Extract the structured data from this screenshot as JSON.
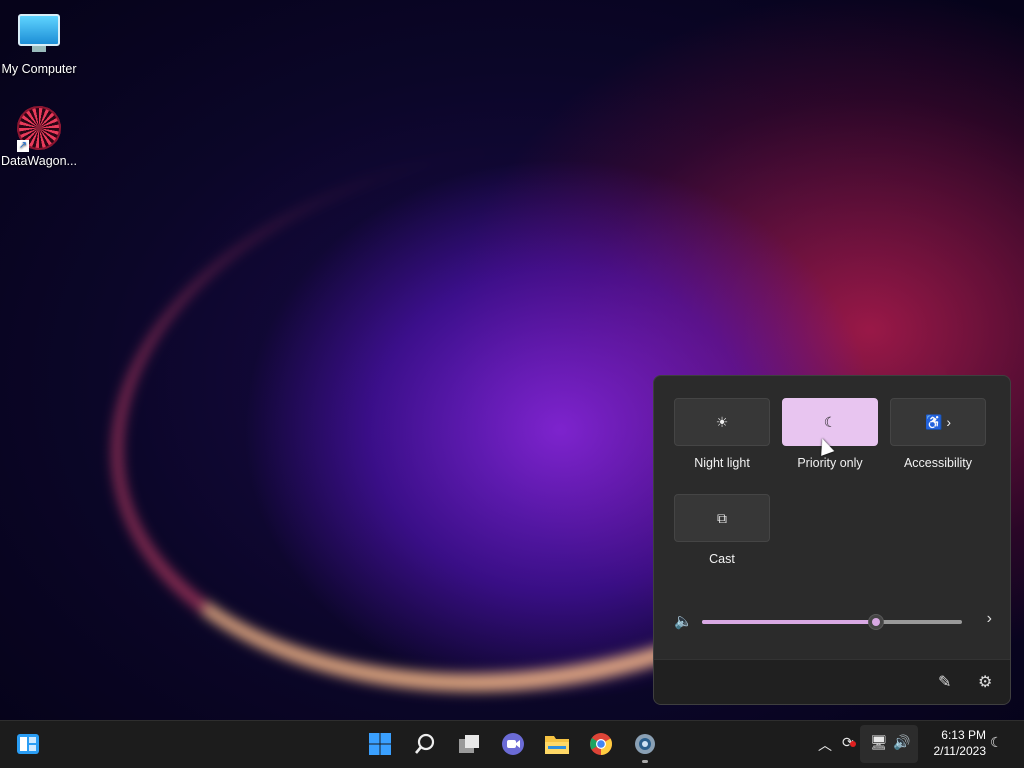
{
  "desktop": {
    "icons": [
      {
        "label": "My Computer",
        "icon": "monitor-icon"
      },
      {
        "label": "DataWagon...",
        "icon": "datawagon-icon"
      }
    ]
  },
  "quick_settings": {
    "tiles": [
      {
        "label": "Night light",
        "icon": "night-light-icon",
        "glyph": "☀",
        "active": false
      },
      {
        "label": "Priority only",
        "icon": "moon-icon",
        "glyph": "☾",
        "active": true
      },
      {
        "label": "Accessibility",
        "icon": "accessibility-icon",
        "glyph": "♿ ›",
        "active": false
      },
      {
        "label": "Cast",
        "icon": "cast-icon",
        "glyph": "⧉",
        "active": false
      }
    ],
    "volume": {
      "level_percent": 67,
      "accent": "#d9a9e4"
    },
    "footer": {
      "edit_icon": "pencil-icon",
      "settings_icon": "gear-icon"
    }
  },
  "taskbar": {
    "apps": [
      "widgets-icon",
      "start-icon",
      "search-icon",
      "task-view-icon",
      "teams-chat-icon",
      "file-explorer-icon",
      "chrome-icon",
      "settings-app-icon"
    ],
    "tray": [
      "chevron-up-icon",
      "sync-icon",
      "network-icon",
      "volume-icon",
      "focus-moon-icon"
    ],
    "clock": {
      "time": "6:13 PM",
      "date": "2/11/2023"
    }
  },
  "colors": {
    "accent": "#e8c5f0",
    "panel": "#2b2b2b",
    "taskbar": "#1c1c1c"
  }
}
